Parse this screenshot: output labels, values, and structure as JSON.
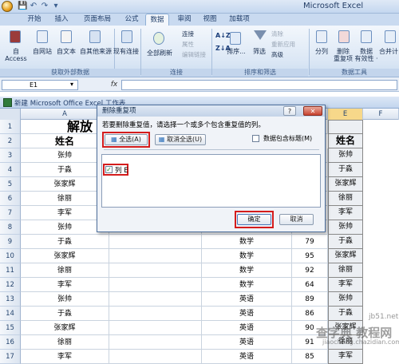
{
  "window": {
    "title": "Microsoft Excel"
  },
  "tabs": [
    "开始",
    "插入",
    "页面布局",
    "公式",
    "数据",
    "审阅",
    "视图",
    "加载项"
  ],
  "ribbon": {
    "ext_data": {
      "access": "自 Access",
      "web": "自网站",
      "text": "自文本",
      "other": "自其他来源",
      "existing": "现有连接",
      "group": "获取外部数据"
    },
    "connections": {
      "refresh": "全部刷新",
      "conn": "连接",
      "props": "属性",
      "edit_links": "编辑链接",
      "group": "连接"
    },
    "sort_filter": {
      "sort": "排序...",
      "filter": "筛选",
      "clear": "清除",
      "reapply": "重新应用",
      "advanced": "高级",
      "group": "排序和筛选"
    },
    "data_tools": {
      "split": "分列",
      "remove_dup": "删除\n重复项",
      "validation": "数据\n有效性 ·",
      "merge": "合并计",
      "group": "数据工具"
    }
  },
  "formula_bar": {
    "cell_ref": "E1",
    "fx": "fx"
  },
  "workbook": {
    "title": "新建 Microsoft Office Excel 工作表"
  },
  "grid": {
    "columns": [
      "A",
      "B",
      "C",
      "D",
      "E",
      "F"
    ],
    "title": "解放",
    "header_name": "姓名",
    "rows": [
      {
        "n": "3",
        "a": "张帅",
        "e": "张帅"
      },
      {
        "n": "4",
        "a": "于淼",
        "e": "于淼"
      },
      {
        "n": "5",
        "a": "张家辉",
        "e": "张家辉"
      },
      {
        "n": "6",
        "a": "徐丽",
        "e": "徐丽"
      },
      {
        "n": "7",
        "a": "李军",
        "e": "李军"
      },
      {
        "n": "8",
        "a": "张帅",
        "e": "张帅"
      },
      {
        "n": "9",
        "a": "于淼",
        "c": "数学",
        "d": "79",
        "e": "于淼"
      },
      {
        "n": "10",
        "a": "张家辉",
        "c": "数学",
        "d": "95",
        "e": "张家辉"
      },
      {
        "n": "11",
        "a": "徐丽",
        "c": "数学",
        "d": "92",
        "e": "徐丽"
      },
      {
        "n": "12",
        "a": "李军",
        "c": "数学",
        "d": "64",
        "e": "李军"
      },
      {
        "n": "13",
        "a": "张帅",
        "c": "英语",
        "d": "89",
        "e": "张帅"
      },
      {
        "n": "14",
        "a": "于淼",
        "c": "英语",
        "d": "86",
        "e": "于淼"
      },
      {
        "n": "15",
        "a": "张家辉",
        "c": "英语",
        "d": "90",
        "e": "张家辉"
      },
      {
        "n": "16",
        "a": "徐丽",
        "c": "英语",
        "d": "91",
        "e": "徐丽"
      },
      {
        "n": "17",
        "a": "李军",
        "c": "英语",
        "d": "85",
        "e": "李军"
      }
    ],
    "row_numbers_top": [
      "1",
      "2"
    ]
  },
  "dialog": {
    "title": "删除重复项",
    "help": "?",
    "close": "✕",
    "instruction": "若要删除重复值，请选择一个或多个包含重复值的列。",
    "select_all": "全选(A)",
    "unselect_all": "取消全选(U)",
    "header_checkbox": "数据包含标题(M)",
    "list_header": "列",
    "list_items": [
      {
        "label": "列 E",
        "checked": true
      }
    ],
    "ok": "确定",
    "cancel": "取消"
  },
  "watermark": {
    "text": "查字典 教程网",
    "url": "jiaocheng.chazidian.com",
    "site": "jb51.net"
  }
}
